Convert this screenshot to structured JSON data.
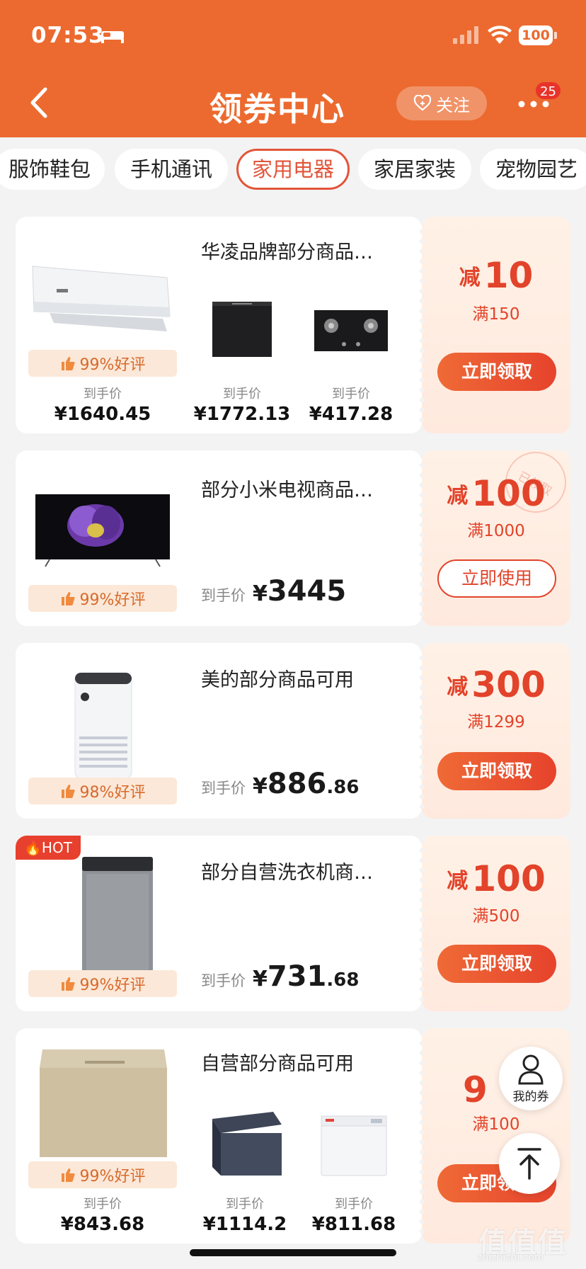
{
  "status_bar": {
    "time": "07:53",
    "battery": "100"
  },
  "nav": {
    "title": "领券中心",
    "follow_label": "关注",
    "badge": "25"
  },
  "tabs": [
    "服饰鞋包",
    "手机通讯",
    "家用电器",
    "家居家装",
    "宠物园艺"
  ],
  "active_tab": "家用电器",
  "cards": [
    {
      "title": "华凌品牌部分商品…",
      "rating": "99%好评",
      "main_price_label": "到手价",
      "main_price": "¥1640.45",
      "sub_items": [
        {
          "label": "到手价",
          "price": "¥1772.13"
        },
        {
          "label": "到手价",
          "price": "¥417.28"
        }
      ],
      "discount_prefix": "减",
      "discount_amount": "10",
      "threshold": "满150",
      "button": "立即领取"
    },
    {
      "title": "部分小米电视商品…",
      "rating": "99%好评",
      "price_label": "到手价",
      "price_currency": "¥",
      "price_int": "3445",
      "price_dec": "",
      "discount_prefix": "减",
      "discount_amount": "100",
      "threshold": "满1000",
      "button": "立即使用",
      "stamp": "已领取"
    },
    {
      "title": "美的部分商品可用",
      "rating": "98%好评",
      "price_label": "到手价",
      "price_currency": "¥",
      "price_int": "886",
      "price_dec": ".86",
      "discount_prefix": "减",
      "discount_amount": "300",
      "threshold": "满1299",
      "button": "立即领取"
    },
    {
      "title": "部分自营洗衣机商…",
      "hot_tag": "HOT",
      "rating": "99%好评",
      "price_label": "到手价",
      "price_currency": "¥",
      "price_int": "731",
      "price_dec": ".68",
      "discount_prefix": "减",
      "discount_amount": "100",
      "threshold": "满500",
      "button": "立即领取"
    },
    {
      "title": "自营部分商品可用",
      "rating": "99%好评",
      "main_price_label": "到手价",
      "main_price": "¥843.68",
      "sub_items": [
        {
          "label": "到手价",
          "price": "¥1114.2"
        },
        {
          "label": "到手价",
          "price": "¥811.68"
        }
      ],
      "discount_amount": "9",
      "threshold": "满100",
      "button": "立即领取"
    }
  ],
  "floaters": {
    "my_coupons": "我的券"
  },
  "watermark": {
    "text": "值值值",
    "sub": "zhizhizhi.com"
  },
  "colors": {
    "brand": "#ec6a2f",
    "accent": "#e2432a"
  }
}
